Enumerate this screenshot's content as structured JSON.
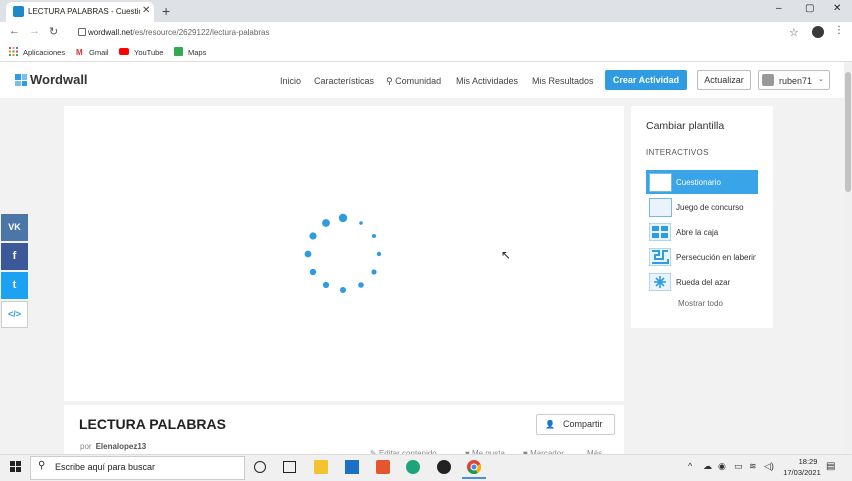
{
  "browser": {
    "tab_title": "LECTURA PALABRAS - Cuestionario",
    "tab_close": "✕",
    "new_tab": "+",
    "url_host": "wordwall.net",
    "url_path": "/es/resource/2629122/lectura-palabras",
    "bookmarks": [
      "Aplicaciones",
      "Gmail",
      "YouTube",
      "Maps"
    ],
    "window_controls": [
      "–",
      "▢",
      "✕"
    ],
    "nav_buttons": [
      "←",
      "→",
      "↻"
    ]
  },
  "site": {
    "logo": "Wordwall",
    "nav": [
      "Inicio",
      "Características",
      "Comunidad",
      "Mis Actividades",
      "Mis Resultados"
    ],
    "create_button": "Crear Actividad",
    "update_button": "Actualizar",
    "username": "ruben71"
  },
  "activity": {
    "title": "LECTURA PALABRAS",
    "author_prefix": "por",
    "author": "Elenalopez13",
    "share_button": "Compartir",
    "actions": [
      "Editar contenido",
      "Me gusta",
      "Marcador",
      "Más"
    ]
  },
  "templates": {
    "title": "Cambiar plantilla",
    "section": "INTERACTIVOS",
    "items": [
      {
        "label": "Cuestionario",
        "selected": true
      },
      {
        "label": "Juego de concurso",
        "selected": false
      },
      {
        "label": "Abre la caja",
        "selected": false
      },
      {
        "label": "Persecución en laberinto",
        "selected": false
      },
      {
        "label": "Rueda del azar",
        "selected": false
      }
    ],
    "more": "Mostrar todo"
  },
  "social": [
    "VK",
    "f",
    "t",
    "</>"
  ],
  "social_colors": [
    "#4a76a8",
    "#3b5998",
    "#1da1f2",
    "#ffffff"
  ],
  "taskbar": {
    "search_placeholder": "Escribe aquí para buscar",
    "time": "18:29",
    "date": "17/03/2021"
  },
  "colors": {
    "accent": "#2f9be3",
    "spinner": "#2f9be3"
  }
}
